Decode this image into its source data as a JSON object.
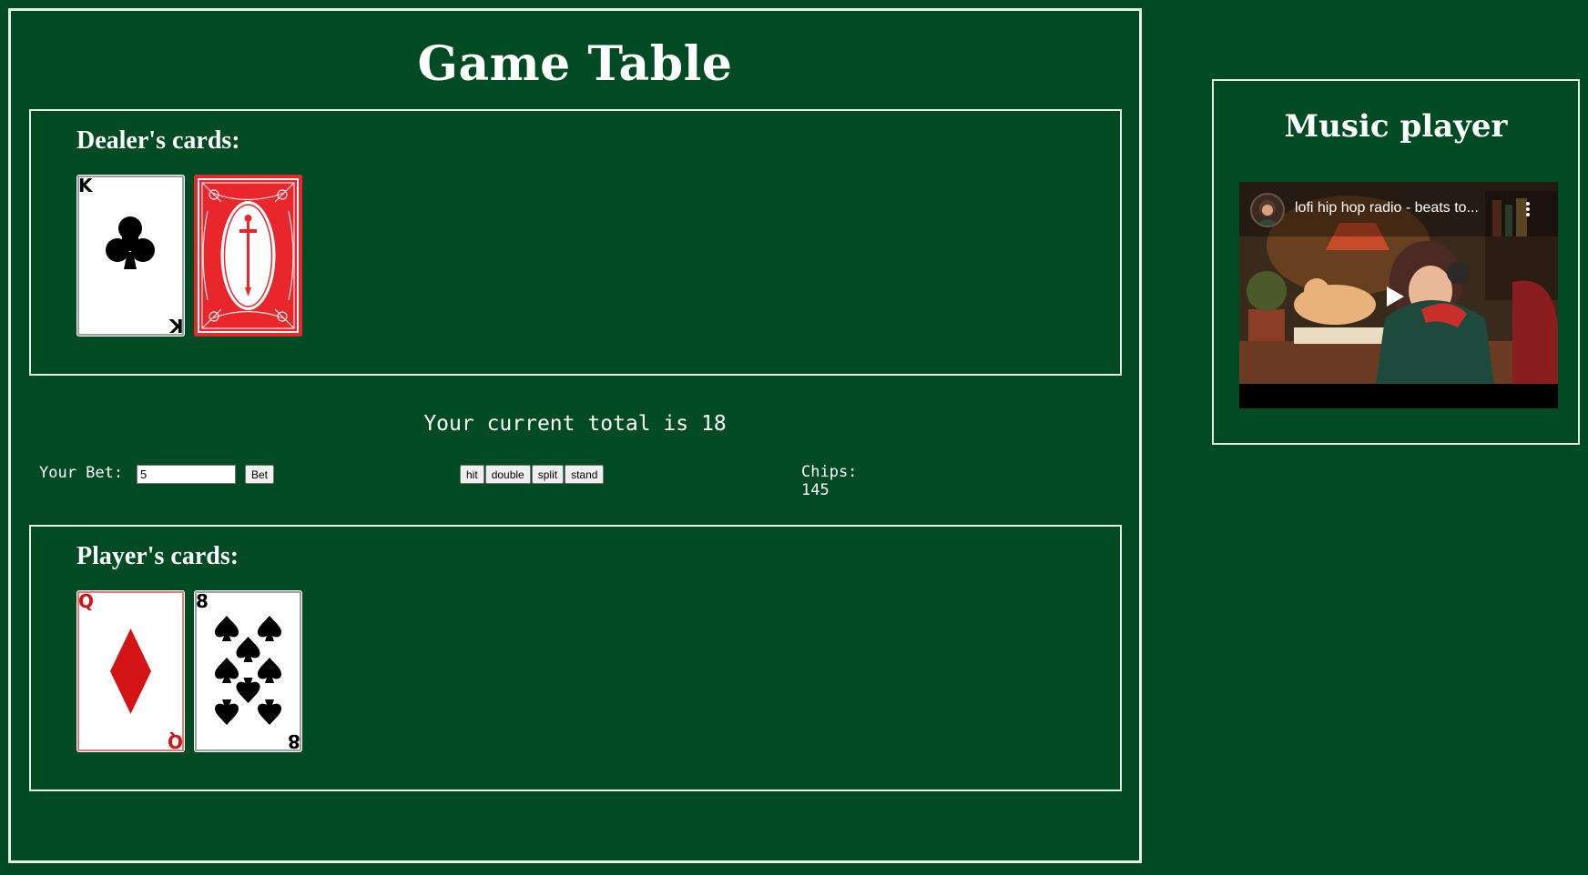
{
  "game": {
    "title": "Game Table",
    "dealer_label": "Dealer's cards:",
    "player_label": "Player's cards:",
    "dealer_cards": [
      {
        "rank": "K",
        "suit": "clubs",
        "face_up": true
      },
      {
        "rank": "",
        "suit": "",
        "face_up": false
      }
    ],
    "player_cards": [
      {
        "rank": "Q",
        "suit": "diamonds",
        "face_up": true
      },
      {
        "rank": "8",
        "suit": "spades",
        "face_up": true
      }
    ],
    "total_text": "Your current total is 18",
    "bet": {
      "label": "Your Bet:",
      "value": "5",
      "button": "Bet"
    },
    "actions": {
      "hit": "hit",
      "double": "double",
      "split": "split",
      "stand": "stand"
    },
    "chips": {
      "label": "Chips:",
      "value": "145"
    }
  },
  "music": {
    "title": "Music player",
    "video_title": "lofi hip hop radio - beats to...",
    "icons": [
      "channel-avatar",
      "more-vert-icon",
      "play-icon"
    ]
  },
  "colors": {
    "felt": "#004b23",
    "border": "#e8efe8",
    "card_red": "#d41414",
    "card_back_red": "#e8262b"
  }
}
